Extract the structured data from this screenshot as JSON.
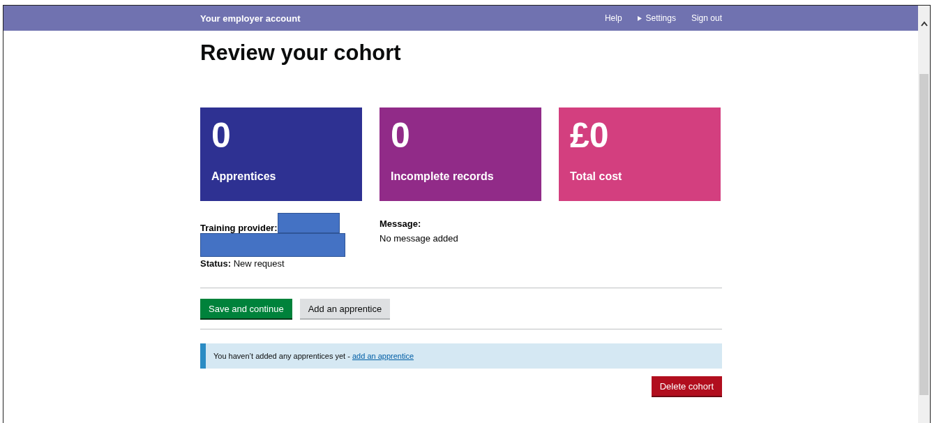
{
  "header": {
    "title": "Your employer account",
    "links": [
      {
        "label": "Help",
        "kind": "plain"
      },
      {
        "label": "Settings",
        "kind": "menu"
      },
      {
        "label": "Sign out",
        "kind": "plain"
      }
    ]
  },
  "page_title": "Review your cohort",
  "stats": [
    {
      "value": "0",
      "label": "Apprentices",
      "color": "#2e3192"
    },
    {
      "value": "0",
      "label": "Incomplete records",
      "color": "#912b88"
    },
    {
      "value": "£0",
      "label": "Total cost",
      "color": "#d33f7f"
    }
  ],
  "details": {
    "provider_label": "Training provider:",
    "status_label": "Status:",
    "status": "New request",
    "message_label": "Message:",
    "message": "No message added"
  },
  "buttons": [
    {
      "label": "Save and continue",
      "kind": "primary"
    },
    {
      "label": "Add an apprentice",
      "kind": "secondary"
    }
  ],
  "notice": {
    "text": "You haven’t added any apprentices yet - ",
    "link": "add an apprentice"
  },
  "delete_button": "Delete cohort"
}
